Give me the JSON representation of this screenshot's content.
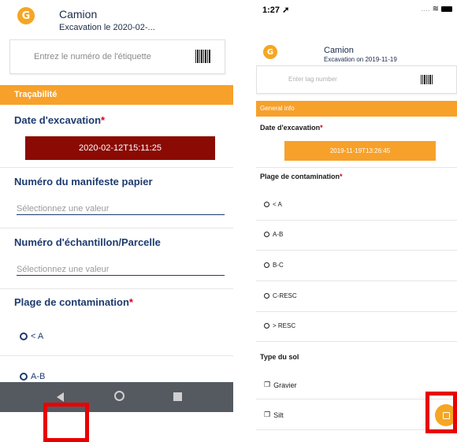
{
  "left": {
    "header": {
      "title": "Camion",
      "subtitle": "Excavation le 2020-02-..."
    },
    "tag_input": {
      "placeholder": "Entrez le numéro de l'étiquette"
    },
    "section": {
      "label": "Traçabilité"
    },
    "date": {
      "label": "Date d'excavation",
      "required": "*",
      "value": "2020-02-12T15:11:25"
    },
    "manifest": {
      "label": "Numéro du manifeste papier",
      "placeholder": "Sélectionnez une valeur"
    },
    "sample": {
      "label": "Numéro d'échantillon/Parcelle",
      "placeholder": "Sélectionnez une valeur"
    },
    "contamination": {
      "label": "Plage de contamination",
      "required": "*",
      "options": [
        "< A",
        "A-B"
      ]
    }
  },
  "right": {
    "status": {
      "time": "1:27",
      "signal": "....",
      "wifi": "≋"
    },
    "header": {
      "title": "Camion",
      "subtitle": "Excavation on 2019-11-19"
    },
    "tag_input": {
      "placeholder": "Enter tag number"
    },
    "section": {
      "label": "General info"
    },
    "date": {
      "label": "Date d'excavation",
      "required": "*",
      "value": "2019-11-19T13:26:45"
    },
    "contamination": {
      "label": "Plage de contamination",
      "required": "*",
      "options": [
        "< A",
        "A-B",
        "B-C",
        "C-RESC",
        "> RESC"
      ]
    },
    "soil": {
      "label": "Type du sol",
      "options": [
        "Gravier",
        "Silt"
      ]
    }
  },
  "colors": {
    "accent": "#f7a12b",
    "date_button_left": "#8b0a03",
    "date_button_right": "#f7a12b",
    "label_text": "#1e3b6e",
    "required": "#d0021b",
    "highlight": "#e80000"
  },
  "icons": {
    "logo": "logo-g-icon",
    "barcode": "barcode-icon",
    "back": "back-icon",
    "home": "home-icon",
    "recent": "recent-apps-icon",
    "save": "save-icon"
  }
}
